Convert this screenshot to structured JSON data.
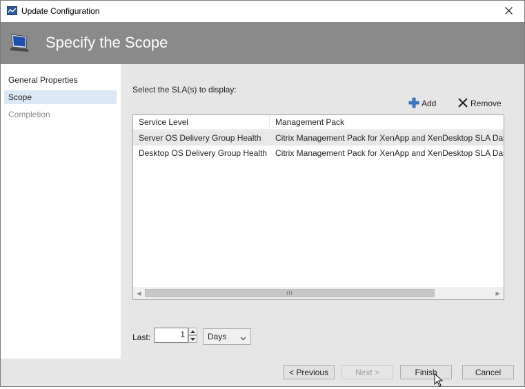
{
  "window": {
    "title": "Update Configuration"
  },
  "banner": {
    "title": "Specify the Scope"
  },
  "nav": {
    "items": [
      {
        "label": "General Properties",
        "state": "normal"
      },
      {
        "label": "Scope",
        "state": "selected"
      },
      {
        "label": "Completion",
        "state": "disabled"
      }
    ]
  },
  "main": {
    "prompt": "Select the SLA(s) to display:",
    "add_label": "Add",
    "remove_label": "Remove",
    "table": {
      "columns": [
        "Service Level",
        "Management Pack"
      ],
      "rows": [
        [
          "Server OS Delivery Group Health",
          "Citrix Management Pack for XenApp and XenDesktop SLA Dashboard"
        ],
        [
          "Desktop OS Delivery Group Health",
          "Citrix Management Pack for XenApp and XenDesktop SLA Dashboard"
        ]
      ]
    },
    "scroll_grip": "III",
    "last_label": "Last:",
    "last_value": "1",
    "unit_value": "Days"
  },
  "footer": {
    "previous_label": "< Previous",
    "next_label": "Next >",
    "finish_label": "Finish",
    "cancel_label": "Cancel"
  },
  "colors": {
    "banner": "#8a8a8a",
    "panel": "#e6e6e6",
    "nav_selected": "#dbe8f6",
    "add_icon": "#3a7ac8"
  }
}
